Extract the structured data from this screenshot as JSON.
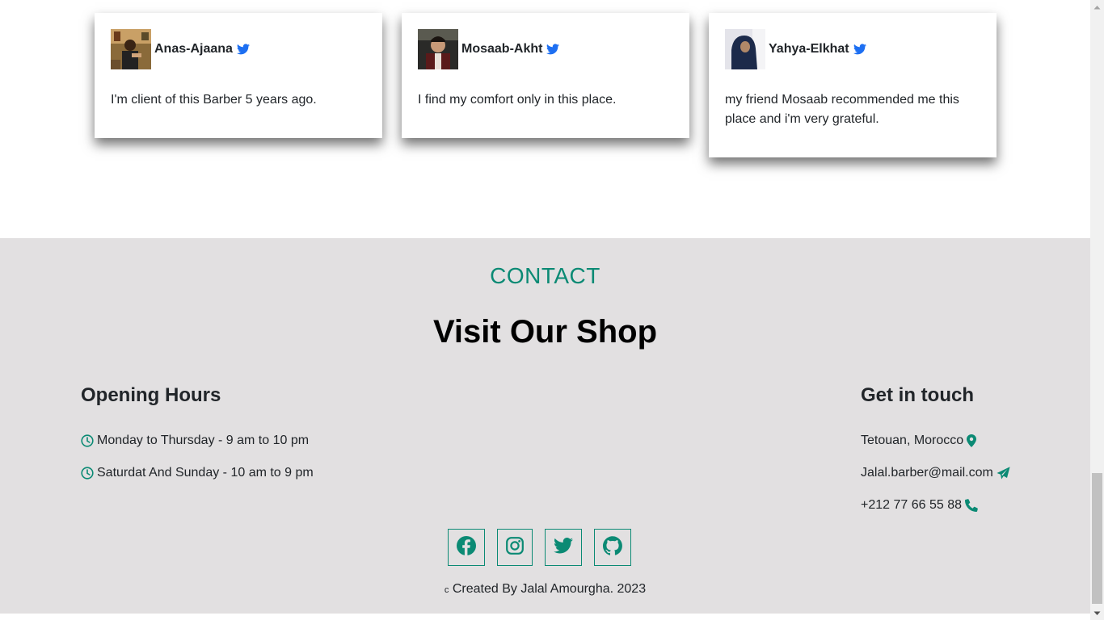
{
  "testimonials": [
    {
      "name": "Anas-Ajaana",
      "quote": "I'm client of this Barber 5 years ago."
    },
    {
      "name": "Mosaab-Akht",
      "quote": "I find my comfort only in this place."
    },
    {
      "name": "Yahya-Elkhat",
      "quote": "my friend Mosaab recommended me this place and i'm very grateful."
    }
  ],
  "contact": {
    "eyebrow": "CONTACT",
    "headline": "Visit Our Shop",
    "hours_title": "Opening Hours",
    "hours": [
      "Monday to Thursday - 9 am to 10 pm",
      "Saturdat And Sunday - 10 am to 9 pm"
    ],
    "touch_title": "Get in touch",
    "location": "Tetouan, Morocco",
    "email": "Jalal.barber@mail.com",
    "phone": "+212 77 66 55 88"
  },
  "footer": {
    "copyright_symbol": "c",
    "copyright": "Created By Jalal Amourgha. 2023"
  },
  "icons": {
    "twitter": "twitter-icon",
    "clock": "clock-icon",
    "location": "map-pin-icon",
    "email": "paper-plane-icon",
    "phone": "phone-icon",
    "social": [
      "facebook-icon",
      "instagram-icon",
      "twitter-icon",
      "github-icon"
    ]
  },
  "colors": {
    "accent": "#0b8a74",
    "twitter_blue": "#1d6ff2",
    "contact_bg": "#e2e0e1"
  }
}
